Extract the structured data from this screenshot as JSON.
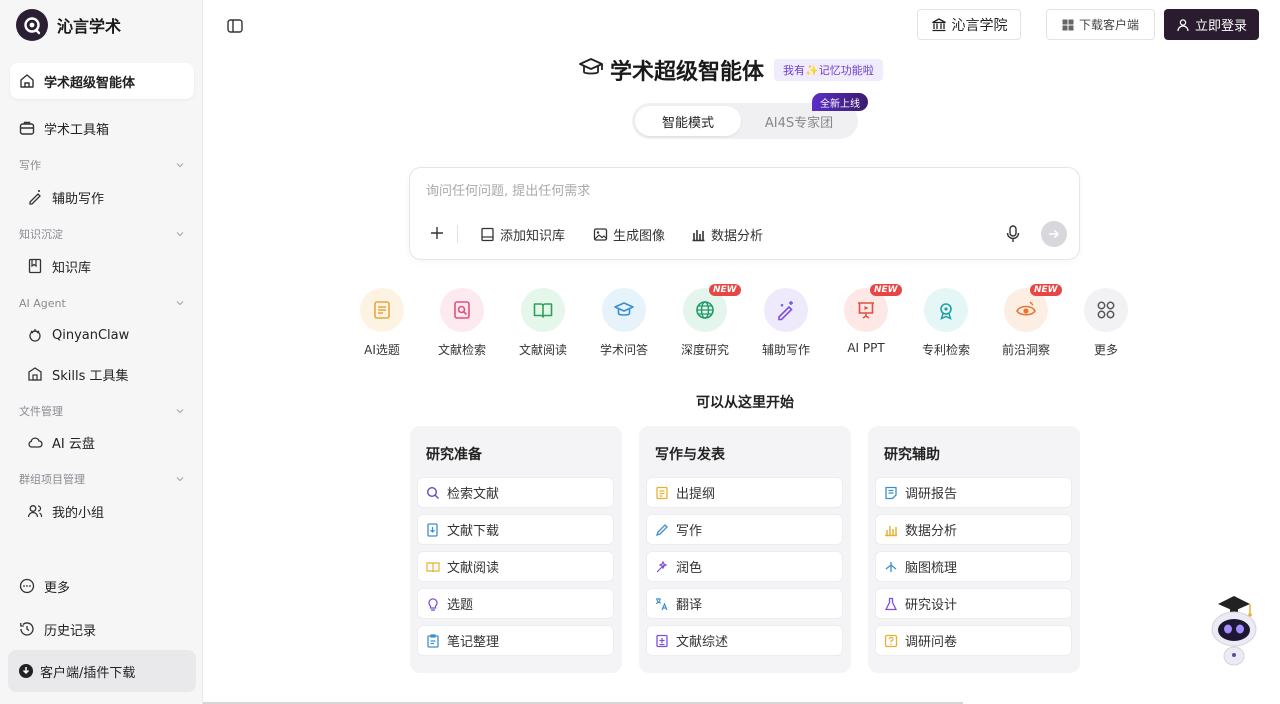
{
  "brand": {
    "name": "沁言学术"
  },
  "sidebar": {
    "main_items": [
      {
        "label": "学术超级智能体",
        "icon": "home-icon"
      },
      {
        "label": "学术工具箱",
        "icon": "toolbox-icon"
      }
    ],
    "sections": [
      {
        "title": "写作",
        "items": [
          {
            "label": "辅助写作",
            "icon": "pen-sparkle-icon"
          }
        ]
      },
      {
        "title": "知识沉淀",
        "items": [
          {
            "label": "知识库",
            "icon": "book-icon"
          }
        ]
      },
      {
        "title": "AI Agent",
        "items": [
          {
            "label": "QinyanClaw",
            "icon": "claw-icon"
          },
          {
            "label": "Skills 工具集",
            "icon": "skills-icon"
          }
        ]
      },
      {
        "title": "文件管理",
        "items": [
          {
            "label": "AI 云盘",
            "icon": "cloud-icon"
          }
        ]
      },
      {
        "title": "群组项目管理",
        "items": [
          {
            "label": "我的小组",
            "icon": "group-icon"
          }
        ]
      }
    ],
    "more": "更多",
    "history": "历史记录",
    "download": "客户端/插件下载"
  },
  "header": {
    "academy": "沁言学院",
    "client_download": "下载客户端",
    "login": "立即登录"
  },
  "hero": {
    "title": "学术超级智能体",
    "memory_tag": "我有✨记忆功能啦",
    "modes": [
      "智能模式",
      "AI4S专家团"
    ],
    "new_badge": "全新上线"
  },
  "search": {
    "placeholder": "询问任何问题, 提出任何需求",
    "tools": [
      "添加知识库",
      "生成图像",
      "数据分析"
    ]
  },
  "quick_tools": [
    {
      "label": "AI选题",
      "new": false,
      "bg": "#fdf3e3",
      "color": "#e8a640"
    },
    {
      "label": "文献检索",
      "new": false,
      "bg": "#fdeaf0",
      "color": "#e0507a"
    },
    {
      "label": "文献阅读",
      "new": false,
      "bg": "#e5f6ea",
      "color": "#2fa05a"
    },
    {
      "label": "学术问答",
      "new": false,
      "bg": "#e6f3fb",
      "color": "#3a8fd0"
    },
    {
      "label": "深度研究",
      "new": true,
      "bg": "#e4f5ee",
      "color": "#1f9a6a"
    },
    {
      "label": "辅助写作",
      "new": false,
      "bg": "#efeafb",
      "color": "#7c4fe0"
    },
    {
      "label": "AI PPT",
      "new": true,
      "bg": "#fde8e6",
      "color": "#e05040"
    },
    {
      "label": "专利检索",
      "new": false,
      "bg": "#e5f6f6",
      "color": "#20a0a0"
    },
    {
      "label": "前沿洞察",
      "new": true,
      "bg": "#fdeee4",
      "color": "#e87530"
    },
    {
      "label": "更多",
      "new": false,
      "bg": "#f2f2f4",
      "color": "#555555"
    }
  ],
  "new_label": "NEW",
  "start_title": "可以从这里开始",
  "cards": [
    {
      "title": "研究准备",
      "items": [
        "检索文献",
        "文献下载",
        "文献阅读",
        "选题",
        "笔记整理"
      ]
    },
    {
      "title": "写作与发表",
      "items": [
        "出提纲",
        "写作",
        "润色",
        "翻译",
        "文献综述"
      ]
    },
    {
      "title": "研究辅助",
      "items": [
        "调研报告",
        "数据分析",
        "脑图梳理",
        "研究设计",
        "调研问卷"
      ]
    }
  ]
}
